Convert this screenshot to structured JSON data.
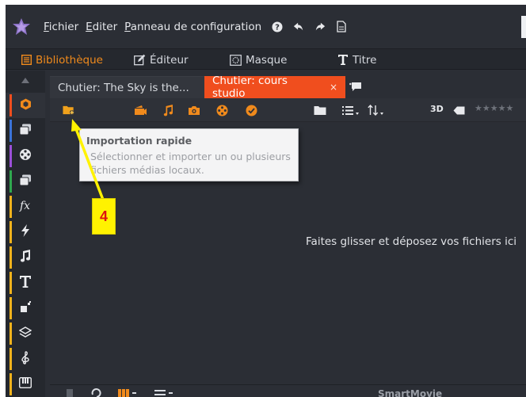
{
  "menu": {
    "items": [
      "Fichier",
      "Editer",
      "Panneau de configuration"
    ]
  },
  "modes": {
    "library": "Bibliothèque",
    "editor": "Éditeur",
    "mask": "Masque",
    "title": "Titre"
  },
  "bins": {
    "tab1": "Chutier: The Sky is the...",
    "tab2": "Chutier: cours studio",
    "close_glyph": "×"
  },
  "toolbar": {
    "view_3d": "3D",
    "rating_stars": "★★★★★"
  },
  "tooltip": {
    "title": "Importation rapide",
    "body_line1": "Sélectionner et importer un ou plusieurs",
    "body_line2": "fichiers médias locaux."
  },
  "content": {
    "drop_hint": "Faites glisser et déposez vos fichiers ici"
  },
  "annotation": {
    "label": "4"
  },
  "bottom": {
    "label": "SmartMovie"
  },
  "colors": {
    "accent": "#f08a1c",
    "active_tab": "#f04e1e",
    "callout": "#fff200"
  }
}
